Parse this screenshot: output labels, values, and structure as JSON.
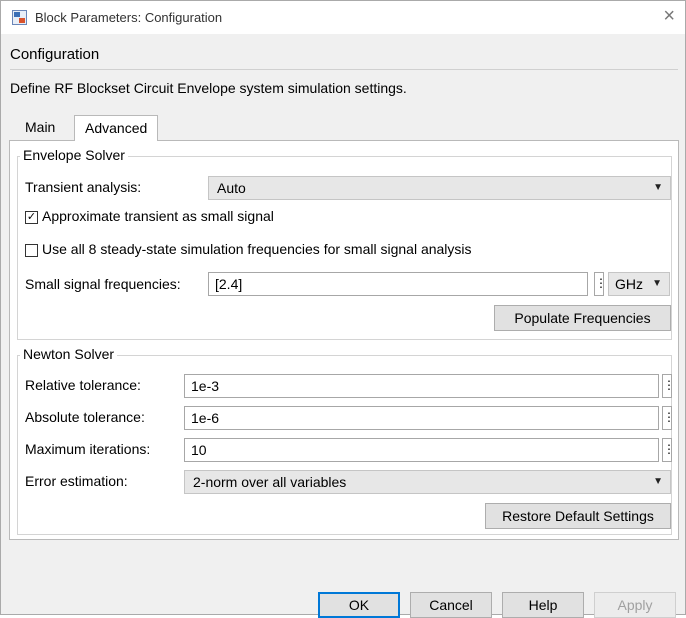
{
  "window": {
    "title": "Block Parameters: Configuration",
    "close_icon": "×"
  },
  "header": {
    "block_name": "Configuration",
    "description": "Define RF Blockset Circuit Envelope system simulation settings."
  },
  "tabs": [
    {
      "label": "Main",
      "active": false
    },
    {
      "label": "Advanced",
      "active": true
    }
  ],
  "envelope": {
    "legend": "Envelope Solver",
    "transient_label": "Transient analysis:",
    "transient_value": "Auto",
    "approx_label": "Approximate transient as small signal",
    "approx_checked": true,
    "use_all_label": "Use all 8 steady-state simulation frequencies for small signal analysis",
    "use_all_checked": false,
    "small_freq_label": "Small signal frequencies:",
    "small_freq_value": "[2.4]",
    "unit_value": "GHz",
    "populate_button": "Populate Frequencies"
  },
  "newton": {
    "legend": "Newton Solver",
    "rel_tol_label": "Relative tolerance:",
    "rel_tol_value": "1e-3",
    "abs_tol_label": "Absolute tolerance:",
    "abs_tol_value": "1e-6",
    "max_iter_label": "Maximum iterations:",
    "max_iter_value": "10",
    "err_est_label": "Error estimation:",
    "err_est_value": "2-norm over all variables",
    "restore_button": "Restore Default Settings"
  },
  "footer": {
    "ok": "OK",
    "cancel": "Cancel",
    "help": "Help",
    "apply": "Apply"
  },
  "icons": {
    "dots_glyph": "⋮",
    "dropdown_glyph": "▼",
    "check_glyph": "✓"
  },
  "colors": {
    "default_button_border": "#0078d7"
  }
}
